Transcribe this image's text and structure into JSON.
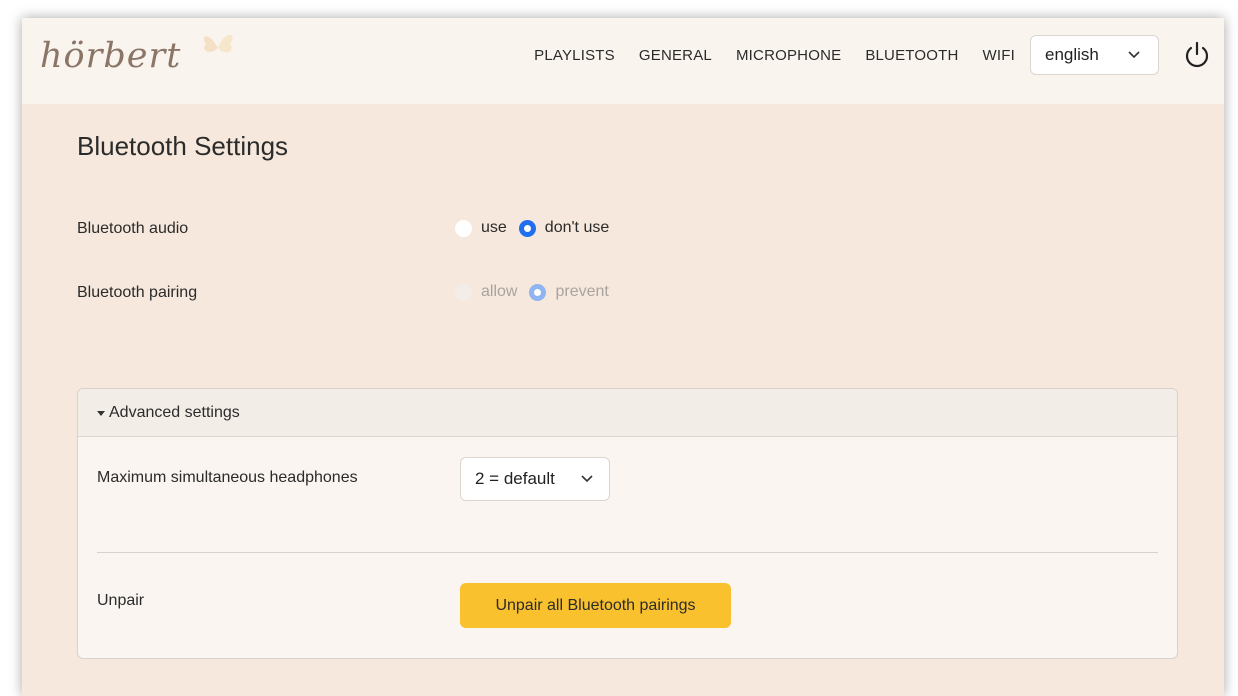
{
  "app": {
    "logo_text": "hörbert"
  },
  "nav": {
    "items": [
      {
        "label": "PLAYLISTS"
      },
      {
        "label": "GENERAL"
      },
      {
        "label": "MICROPHONE"
      },
      {
        "label": "BLUETOOTH"
      },
      {
        "label": "WIFI"
      }
    ],
    "language": "english",
    "power_icon": "power-icon"
  },
  "page": {
    "title": "Bluetooth Settings"
  },
  "settings": {
    "audio": {
      "label": "Bluetooth audio",
      "options": [
        "use",
        "don't use"
      ],
      "selected": "don't use",
      "enabled": true
    },
    "pairing": {
      "label": "Bluetooth pairing",
      "options": [
        "allow",
        "prevent"
      ],
      "selected": "prevent",
      "enabled": false
    }
  },
  "advanced": {
    "header": "Advanced settings",
    "headphones": {
      "label": "Maximum simultaneous headphones",
      "value": "2 = default"
    },
    "unpair": {
      "label": "Unpair",
      "button": "Unpair all Bluetooth pairings"
    }
  },
  "colors": {
    "accent": "#1f6ff0",
    "button": "#f9c12e",
    "background": "#f6e8dc",
    "navbar": "#faf4ef"
  }
}
